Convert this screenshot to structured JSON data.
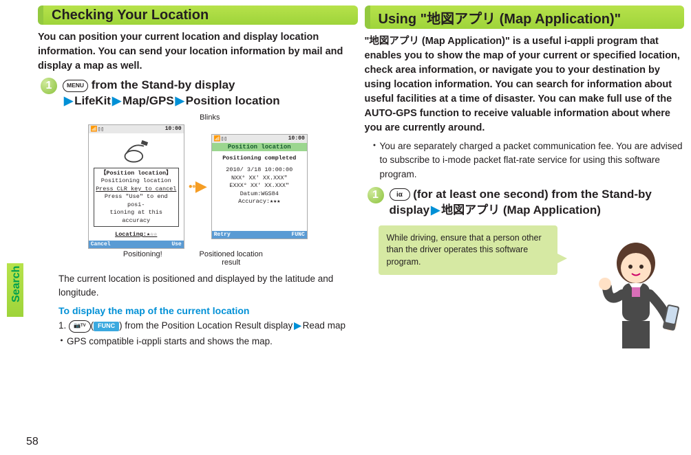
{
  "page_number": "58",
  "side_tab": "Search",
  "left": {
    "title": "Checking Your Location",
    "intro": "You can position your current location and display location information. You can send your location information by mail and display a map as well.",
    "step1": {
      "num": "1",
      "menu_key": "MENU",
      "after_key": " from the Stand-by display",
      "path1": "LifeKit",
      "path2": "Map/GPS",
      "path3": "Position location"
    },
    "blinks_label": "Blinks",
    "phone1": {
      "time": "10:00",
      "section_title": "【Position location】",
      "line1": "Positioning location",
      "line2": "Press CLR key to cancel",
      "line3": "Press \"Use\" to end posi-",
      "line4": "tioning at this accuracy",
      "locating": "Locating:★☆☆",
      "btn_left": "Cancel",
      "btn_right": "Use"
    },
    "phone2": {
      "time": "10:00",
      "header": "Position location",
      "line1": "Positioning completed",
      "line2": "2010/ 3/18 10:00:00",
      "line3": "NXX° XX' XX.XXX\"",
      "line4": "EXXX° XX' XX.XXX\"",
      "line5": "Datum:WGS84",
      "line6": "Accuracy:★★★",
      "btn_left": "Retry",
      "btn_right": "FUNC"
    },
    "caption1": "Positioning!",
    "caption2": "Positioned location result",
    "para_after": "The current location is positioned and displayed by the latitude and longitude.",
    "subhead": "To display the map of the current location",
    "step_detail_key": "📷ⅰ/TV",
    "func_label": "FUNC",
    "step_detail_1a": "1. ",
    "step_detail_1b": ") from the Position Location Result display",
    "step_detail_1c": "Read map",
    "step_detail_bullet": "GPS compatible i-αppli starts and shows the map."
  },
  "right": {
    "title": "Using \"地図アプリ (Map Application)\"",
    "intro": "\"地図アプリ (Map Application)\" is a useful i-αppli program that enables you to show the map of your current or specified location, check area information, or navigate you to your destination by using location information. You can search for information about useful facilities at a time of disaster. You can make full use of the AUTO-GPS function to receive valuable information about where you are currently around.",
    "bullet1": "You are separately charged a packet communication fee. You are advised to subscribe to i-mode packet flat-rate service for using this software program.",
    "step1": {
      "num": "1",
      "key": "iα",
      "line_a": " (for at least one second) from the Stand-by display",
      "path": "地図アプリ (Map Application)"
    },
    "callout": "While driving, ensure that a person other than the driver operates this software program."
  }
}
